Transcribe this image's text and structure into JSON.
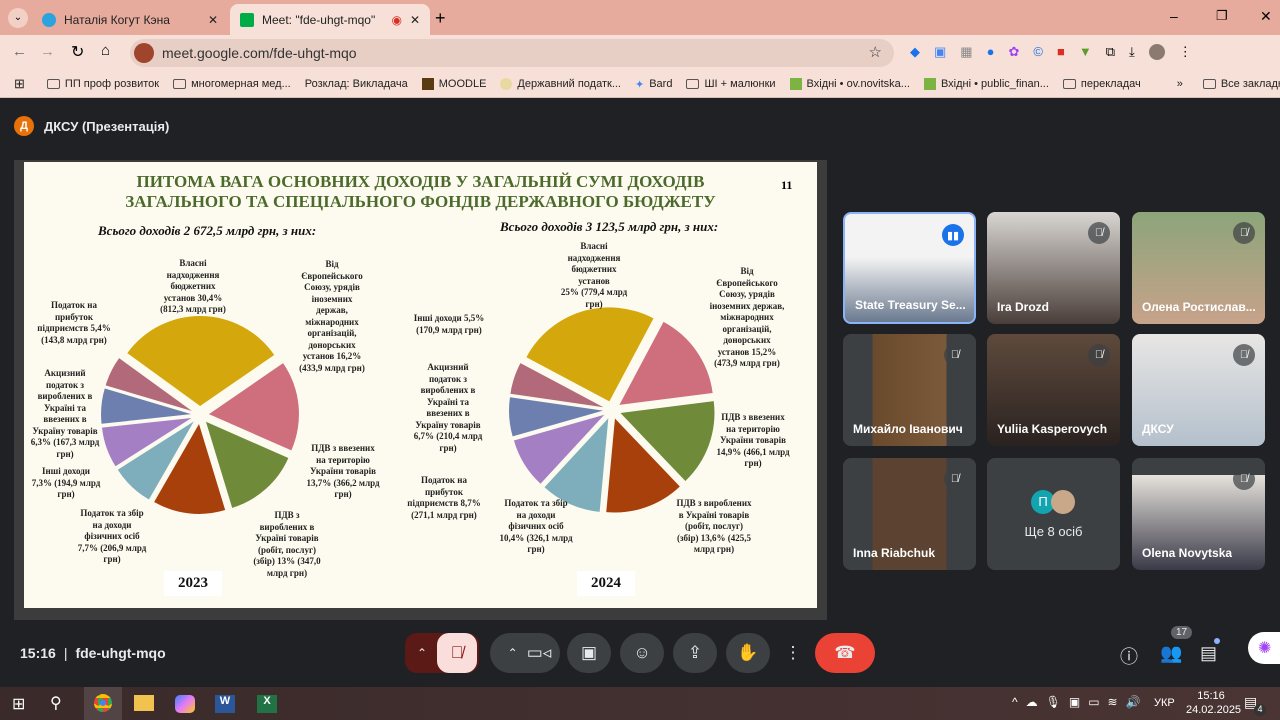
{
  "browser": {
    "tabs": [
      {
        "label": "Наталія Когут Кэна",
        "active": false
      },
      {
        "label": "Meet: \"fde-uhgt-mqo\"",
        "active": true
      }
    ],
    "url": "meet.google.com/fde-uhgt-mqo",
    "bookmarks": [
      "ПП проф розвиток",
      "многомерная мед...",
      "Розклад: Викладача",
      "MOODLE",
      "Державний податк...",
      "Bard",
      "ШІ + малюнки",
      "Вхідні • ov.novitska...",
      "Вхідні • public_finan...",
      "перекладач"
    ],
    "all_bookmarks": "Все закладки"
  },
  "presentation": {
    "avatar": "Д",
    "title": "ДКСУ (Презентація)"
  },
  "slide": {
    "title_line1": "ПИТОМА ВАГА ОСНОВНИХ ДОХОДІВ У ЗАГАЛЬНІЙ СУМІ ДОХОДІВ",
    "title_line2": "ЗАГАЛЬНОГО ТА СПЕЦІАЛЬНОГО ФОНДІВ ДЕРЖАВНОГО БЮДЖЕТУ",
    "page": "11"
  },
  "chart_data": [
    {
      "type": "pie",
      "title": "Всього доходів 2 672,5 млрд грн, з них:",
      "year": "2023",
      "slices": [
        {
          "label": "Власні\nнадходження\nбюджетних\nустанов 30,4%\n(812,3 млрд грн)",
          "value": 30.4,
          "amount": 812.3,
          "color": "#d4a80c"
        },
        {
          "label": "Від\nЄвропейського\nСоюзу, урядів\nіноземних\nдержав,\nміжнародних\nорганізацій,\nдонорських\nустанов 16,2%\n(433,9 млрд грн)",
          "value": 16.2,
          "amount": 433.9,
          "color": "#cf6f7e"
        },
        {
          "label": "ПДВ з ввезених\nна територію\nУкраїни товарів\n13,7% (366,2 млрд\nгрн)",
          "value": 13.7,
          "amount": 366.2,
          "color": "#6f8b3a"
        },
        {
          "label": "ПДВ з\nвироблених в\nУкраїні товарів\n(робіт, послуг)\n(збір) 13% (347,0\nмлрд грн)",
          "value": 13.0,
          "amount": 347.0,
          "color": "#a8400c"
        },
        {
          "label": "Податок та збір\nна доходи\nфізичних осіб\n7,7% (206,9 млрд\nгрн)",
          "value": 7.7,
          "amount": 206.9,
          "color": "#7eaebb"
        },
        {
          "label": "Інші доходи\n7,3% (194,9 млрд\nгрн)",
          "value": 7.3,
          "amount": 194.9,
          "color": "#a57fc4"
        },
        {
          "label": "Акцизний\nподаток з\nвироблених в\nУкраїні та\nввезених в\nУкраїну товарів\n6,3% (167,3 млрд\nгрн)",
          "value": 6.3,
          "amount": 167.3,
          "color": "#6d7fae"
        },
        {
          "label": "Податок на\nприбуток\nпідприємств 5,4%\n(143,8 млрд грн)",
          "value": 5.4,
          "amount": 143.8,
          "color": "#b26a7a"
        }
      ]
    },
    {
      "type": "pie",
      "title": "Всього доходів 3 123,5 млрд грн, з них:",
      "year": "2024",
      "slices": [
        {
          "label": "Власні\nнадходження\nбюджетних\nустанов\n25% (779,4 млрд\nгрн)",
          "value": 25.0,
          "amount": 779.4,
          "color": "#d4a80c"
        },
        {
          "label": "Від\nЄвропейського\nСоюзу, урядів\nіноземних держав,\nміжнародних\nорганізацій,\nдонорських\nустанов 15,2%\n(473,9 млрд грн)",
          "value": 15.2,
          "amount": 473.9,
          "color": "#cf6f7e"
        },
        {
          "label": "ПДВ з ввезених\nна територію\nУкраїни товарів\n14,9% (466,1 млрд\nгрн)",
          "value": 14.9,
          "amount": 466.1,
          "color": "#6f8b3a"
        },
        {
          "label": "ПДВ з вироблених\nв Україні товарів\n(робіт, послуг)\n(збір) 13,6% (425,5\nмлрд грн)",
          "value": 13.6,
          "amount": 425.5,
          "color": "#a8400c"
        },
        {
          "label": "Податок та збір\nна доходи\nфізичних осіб\n10,4% (326,1 млрд\nгрн)",
          "value": 10.4,
          "amount": 326.1,
          "color": "#7eaebb"
        },
        {
          "label": "Податок на\nприбуток\nпідприємств 8,7%\n(271,1 млрд грн)",
          "value": 8.7,
          "amount": 271.1,
          "color": "#a57fc4"
        },
        {
          "label": "Акцизний\nподаток з\nвироблених в\nУкраїні та\nввезених в\nУкраїну товарів\n6,7% (210,4 млрд\nгрн)",
          "value": 6.7,
          "amount": 210.4,
          "color": "#6d7fae"
        },
        {
          "label": "Інші доходи 5,5%\n(170,9 млрд грн)",
          "value": 5.5,
          "amount": 170.9,
          "color": "#b26a7a"
        }
      ]
    }
  ],
  "participants": [
    {
      "name": "State Treasury Se...",
      "muted": false,
      "speaking": true
    },
    {
      "name": "Ira Drozd",
      "muted": true
    },
    {
      "name": "Олена Ростислав...",
      "muted": true
    },
    {
      "name": "Михайло Іванович",
      "muted": true
    },
    {
      "name": "Yuliia Kasperovych",
      "muted": true
    },
    {
      "name": "ДКСУ",
      "muted": true
    },
    {
      "name": "Inna Riabchuk",
      "muted": true
    },
    {
      "name": "Ще 8 осіб",
      "avatar": "П"
    },
    {
      "name": "Olena Novytska",
      "muted": true
    }
  ],
  "meeting": {
    "time": "15:16",
    "code": "fde-uhgt-mqo",
    "participant_count": "17"
  },
  "taskbar": {
    "lang": "УКР",
    "time": "15:16",
    "date": "24.02.2025",
    "notifications": "4"
  }
}
